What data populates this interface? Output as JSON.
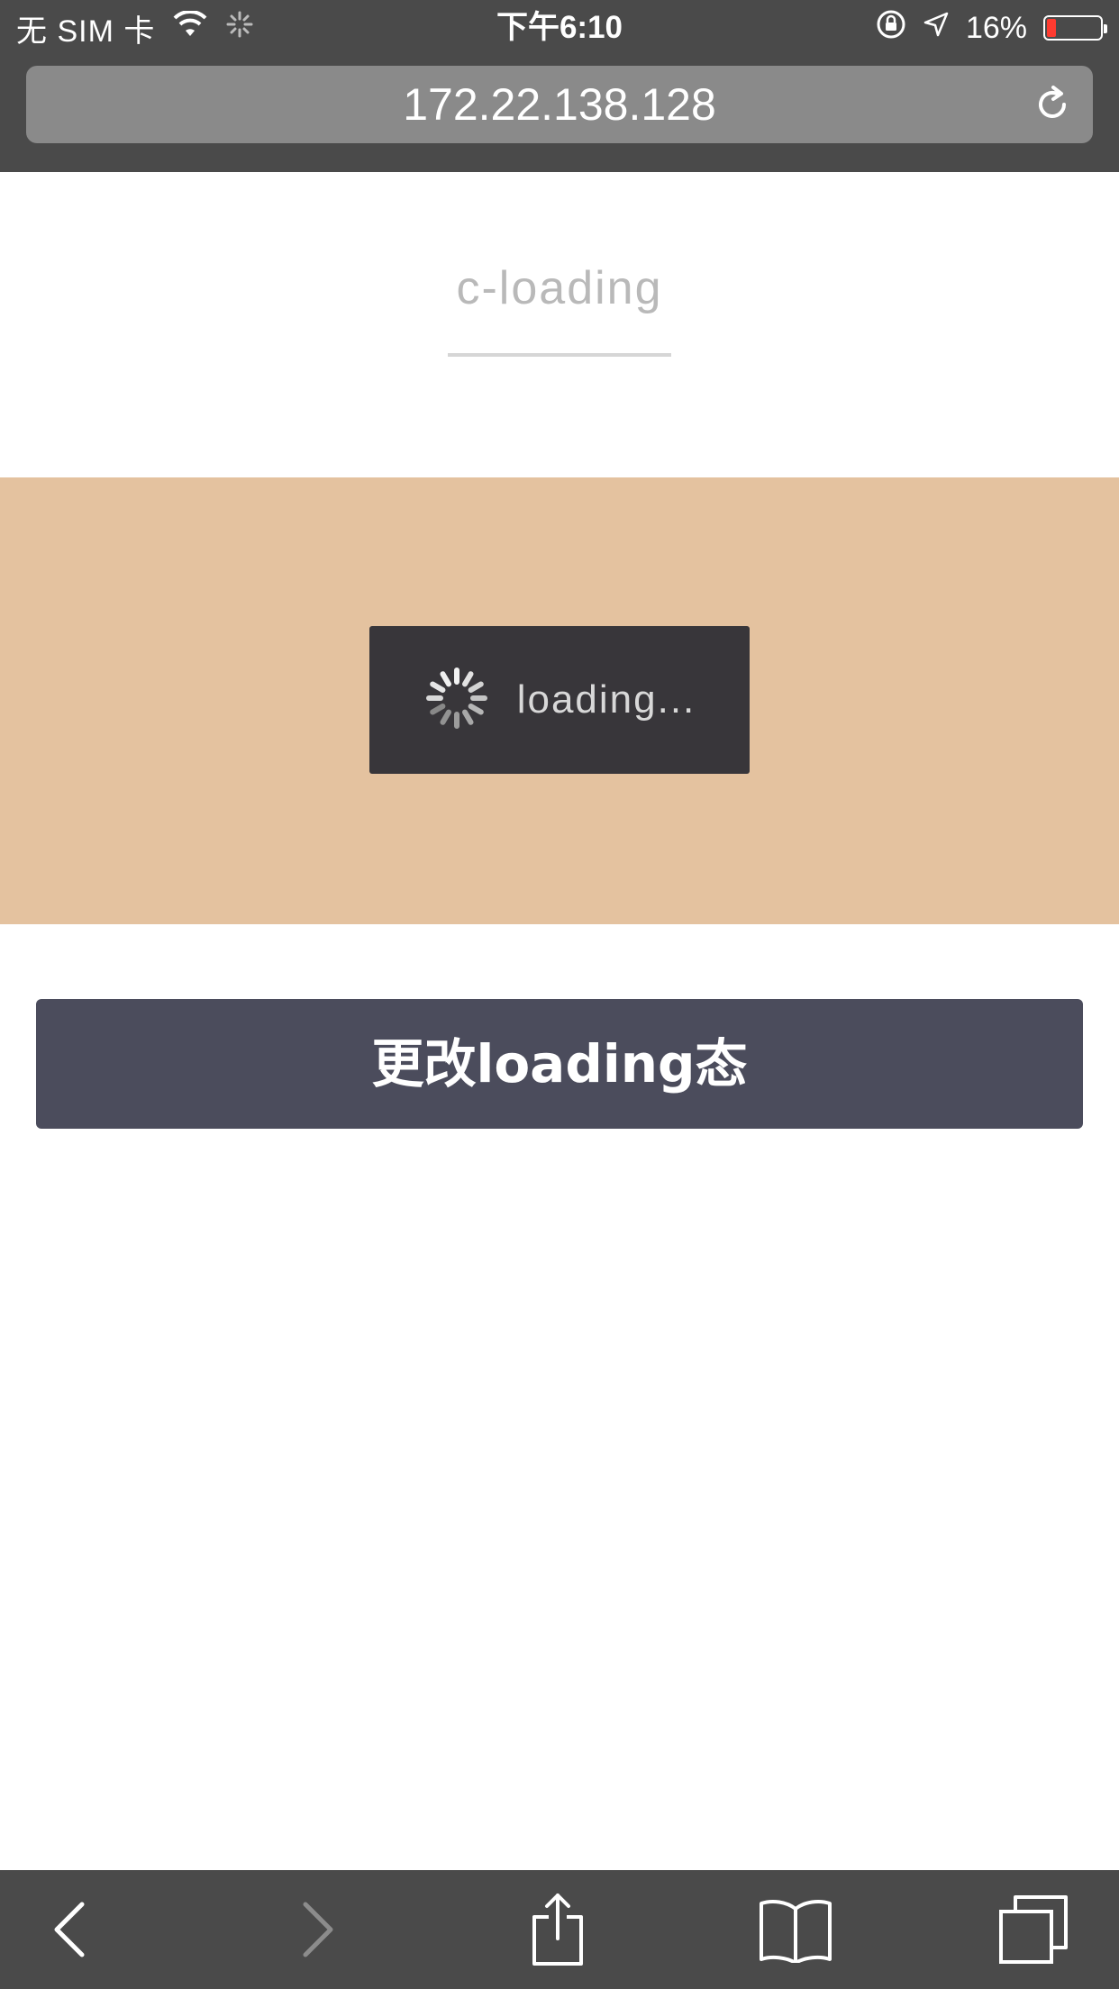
{
  "status_bar": {
    "carrier": "无 SIM 卡",
    "time": "下午6:10",
    "battery_text": "16%",
    "battery_level": 0.16,
    "icons": [
      "wifi-icon",
      "activity-spinner-icon",
      "orientation-lock-icon",
      "location-arrow-icon",
      "battery-icon"
    ]
  },
  "address_bar": {
    "url": "172.22.138.128",
    "reload_icon": "reload-icon"
  },
  "page": {
    "title": "c-loading",
    "loading": {
      "icon": "spinner-icon",
      "text": "loading..."
    },
    "button_label": "更改loading态"
  },
  "toolbar": {
    "items": [
      "back-icon",
      "forward-icon",
      "share-icon",
      "bookmarks-icon",
      "tabs-icon"
    ],
    "forward_enabled": false
  },
  "colors": {
    "chrome": "#4a4a4a",
    "address_bar": "#8a8a8a",
    "demo_background": "#e4c29f",
    "loading_box": "#38363a",
    "button": "#4b4c5c",
    "battery_low": "#ff3b30"
  }
}
